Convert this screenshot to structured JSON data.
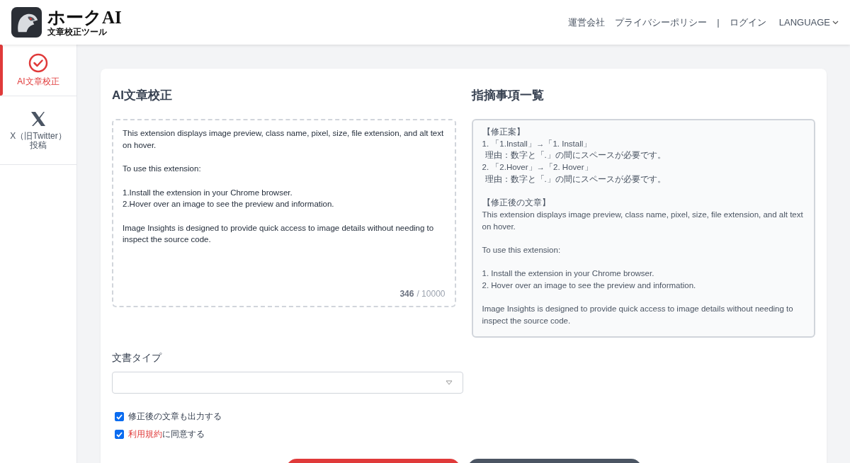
{
  "header": {
    "logo_title": "ホークAI",
    "logo_subtitle": "文章校正ツール",
    "nav": [
      "運営会社",
      "プライバシーポリシー",
      "|",
      "ログイン"
    ],
    "language": "LANGUAGE"
  },
  "sidebar": {
    "items": [
      {
        "label": "AI文章校正",
        "kind": "check",
        "selected": true
      },
      {
        "label": "X（旧Twitter）投稿",
        "kind": "x",
        "selected": false
      }
    ]
  },
  "editor": {
    "title": "AI文章校正",
    "text": "This extension displays image preview, class name, pixel, size, file extension, and alt text on hover.\n\nTo use this extension:\n\n1.Install the extension in your Chrome browser.\n2.Hover over an image to see the preview and information.\n\nImage Insights is designed to provide quick access to image details without needing to inspect the source code.",
    "count": "346",
    "limit": "/ 10000"
  },
  "results": {
    "title": "指摘事項一覧",
    "lines": [
      {
        "kind": "line",
        "text": "【修正案】"
      },
      {
        "kind": "line",
        "text": "1. 「1.Install」→「1. Install」"
      },
      {
        "kind": "reason",
        "text": "理由：数字と「.」の間にスペースが必要です。"
      },
      {
        "kind": "line",
        "text": "2. 「2.Hover」→「2. Hover」"
      },
      {
        "kind": "reason",
        "text": "理由：数字と「.」の間にスペースが必要です。"
      },
      {
        "kind": "paragraph",
        "text": "【修正後の文章】"
      },
      {
        "kind": "line",
        "text": "This extension displays image preview, class name, pixel, size, file extension, and alt text on hover."
      },
      {
        "kind": "paragraph",
        "text": "To use this extension:"
      },
      {
        "kind": "paragraph",
        "text": "1. Install the extension in your Chrome browser.\n2. Hover over an image to see the preview and information."
      },
      {
        "kind": "paragraph",
        "text": "Image Insights is designed to provide quick access to image details without needing to inspect the source code."
      }
    ]
  },
  "document_type": {
    "label": "文書タイプ"
  },
  "options": [
    {
      "text": "修正後の文章も出力する",
      "checked": true
    },
    {
      "link": "利用規約",
      "text": "に同意する",
      "checked": true
    }
  ],
  "buttons": [
    {
      "kind": "primary"
    },
    {
      "kind": "secondary"
    }
  ]
}
